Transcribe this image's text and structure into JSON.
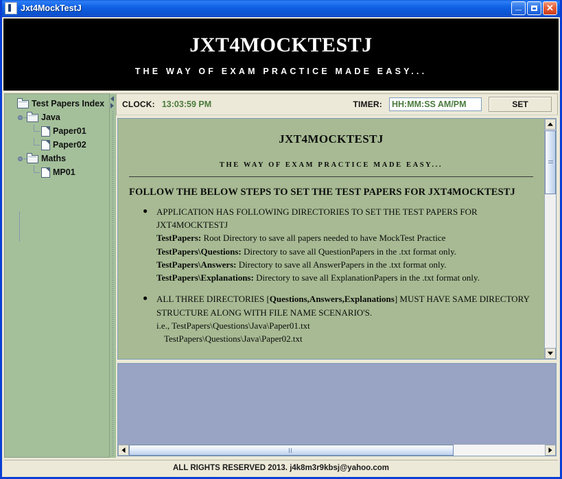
{
  "window": {
    "title": "Jxt4MockTestJ",
    "minimize_label": "Minimize",
    "maximize_label": "Maximize",
    "close_label": "Close",
    "close_glyph": "✕",
    "minimize_glyph": "_"
  },
  "banner": {
    "title": "JXT4MOCKTESTJ",
    "subtitle": "THE WAY OF EXAM PRACTICE MADE EASY..."
  },
  "sidebar": {
    "tree": [
      {
        "label": "Test Papers Index",
        "type": "folder",
        "level": 0
      },
      {
        "label": "Java",
        "type": "folder",
        "level": 1
      },
      {
        "label": "Paper01",
        "type": "file",
        "level": 2
      },
      {
        "label": "Paper02",
        "type": "file",
        "level": 2
      },
      {
        "label": "Maths",
        "type": "folder",
        "level": 1
      },
      {
        "label": "MP01",
        "type": "file",
        "level": 2
      }
    ]
  },
  "toolbar": {
    "clock_label": "CLOCK:",
    "clock_value": "13:03:59 PM",
    "timer_label": "TIMER:",
    "timer_value": "",
    "timer_placeholder": "HH:MM:SS AM/PM",
    "set_label": "SET"
  },
  "document": {
    "title": "JXT4MOCKTESTJ",
    "subtitle": "THE WAY OF EXAM PRACTICE MADE EASY...",
    "heading": "FOLLOW THE BELOW STEPS TO SET THE TEST PAPERS FOR JXT4MOCKTESTJ",
    "bullets": [
      {
        "marker": "●",
        "lines": [
          {
            "text": "APPLICATION HAS FOLLOWING DIRECTORIES TO SET THE TEST PAPERS FOR JXT4MOCKTESTJ"
          },
          {
            "bold": "TestPapers:",
            "text": " Root Directory to save all papers needed to have MockTest Practice"
          },
          {
            "bold": "TestPapers\\Questions:",
            "text": " Directory to save all QuestionPapers in the .txt format only."
          },
          {
            "bold": "TestPapers\\Answers:",
            "text": " Directory to save all AnswerPapers in the .txt format only."
          },
          {
            "bold": "TestPapers\\Explanations:",
            "text": " Directory to save all ExplanationPapers in the .txt format only."
          }
        ]
      },
      {
        "marker": "●",
        "lines": [
          {
            "text": "ALL THREE DIRECTORIES [",
            "bold_mid": "Questions,Answers,Explanations",
            "text_after": "] MUST HAVE SAME DIRECTORY STRUCTURE ALONG WITH FILE NAME SCENARIO'S."
          },
          {
            "text": "i.e., TestPapers\\Questions\\Java\\Paper01.txt"
          },
          {
            "text": "TestPapers\\Questions\\Java\\Paper02.txt"
          }
        ]
      }
    ]
  },
  "status": {
    "text": "ALL RIGHTS RESERVED 2013. j4k8m3r9kbsj@yahoo.com"
  },
  "colors": {
    "title_bar": "#1063e6",
    "banner_bg": "#000000",
    "sidebar_bg": "#a4c09b",
    "document_bg": "#a7ba93",
    "lower_panel_bg": "#99a3c4",
    "clock_green": "#4a7a3c",
    "chrome_beige": "#ece9d8"
  }
}
